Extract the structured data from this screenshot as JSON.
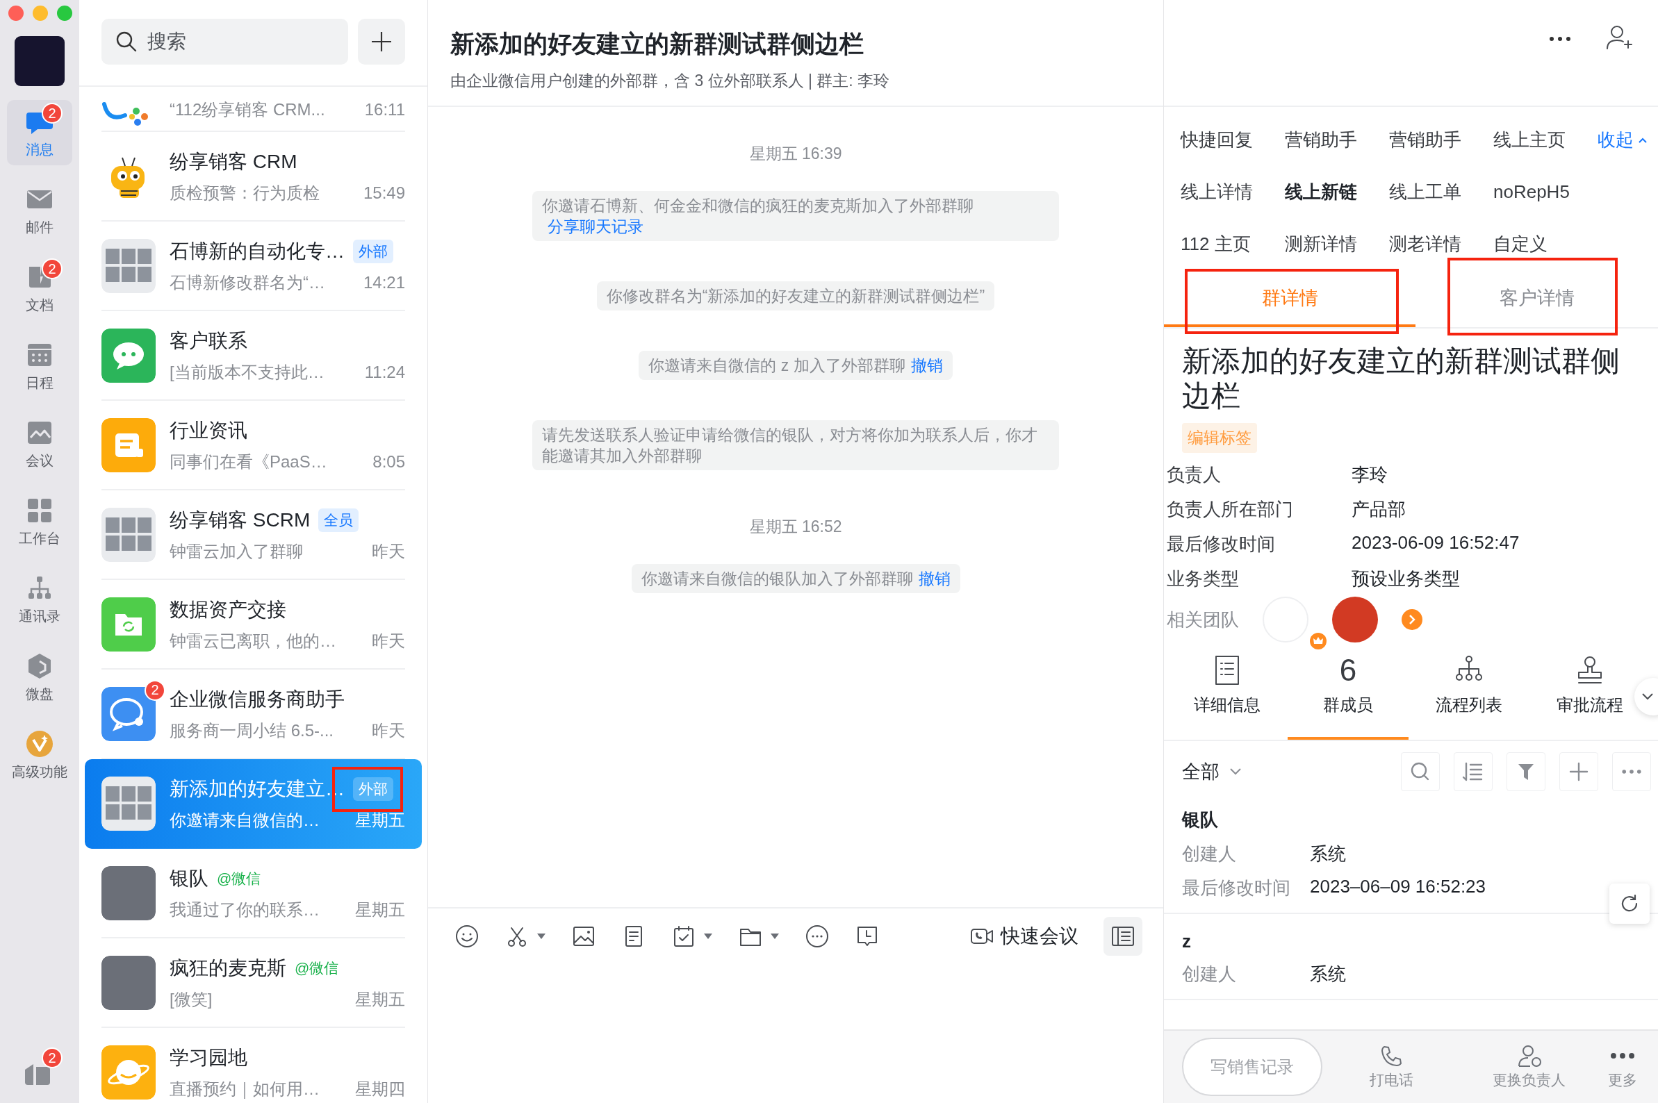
{
  "nav": {
    "items": [
      {
        "label": "消息",
        "selected": true,
        "badge": "2"
      },
      {
        "label": "邮件",
        "selected": false
      },
      {
        "label": "文档",
        "selected": false,
        "badge": "2"
      },
      {
        "label": "日程",
        "selected": false
      },
      {
        "label": "会议",
        "selected": false
      },
      {
        "label": "工作台",
        "selected": false
      },
      {
        "label": "通讯录",
        "selected": false
      },
      {
        "label": "微盘",
        "selected": false
      },
      {
        "label": "高级功能",
        "selected": false
      }
    ],
    "bottom_badge": "2"
  },
  "chat_list": {
    "search": {
      "placeholder": "搜索"
    },
    "items": [
      {
        "preview": "“112纷享销客 CRM...",
        "time": "16:11",
        "selected": false
      },
      {
        "title": "纷享销客 CRM",
        "preview": "质检预警：行为质检",
        "time": "15:49",
        "selected": false
      },
      {
        "title": "石博新的自动化专…",
        "tag": {
          "text": "外部",
          "kind": "blue"
        },
        "preview": "石博新修改群名为“…",
        "time": "14:21",
        "selected": false
      },
      {
        "title": "客户联系",
        "preview": "[当前版本不支持此…",
        "time": "11:24",
        "selected": false
      },
      {
        "title": "行业资讯",
        "preview": "同事们在看《PaaS…",
        "time": "8:05",
        "selected": false
      },
      {
        "title": "纷享销客 SCRM",
        "tag": {
          "text": "全员",
          "kind": "blue"
        },
        "preview": "钟雷云加入了群聊",
        "time": "昨天",
        "selected": false
      },
      {
        "title": "数据资产交接",
        "preview": "钟雷云已离职，他的…",
        "time": "昨天",
        "selected": false
      },
      {
        "title": "企业微信服务商助手",
        "badge": "2",
        "preview": "服务商一周小结 6.5-...",
        "time": "昨天",
        "selected": false
      },
      {
        "title": "新添加的好友建立…",
        "tag": {
          "text": "外部",
          "kind": "blue",
          "highlighted": true
        },
        "preview": "你邀请来自微信的…",
        "time": "星期五",
        "selected": true
      },
      {
        "title": "银队",
        "tag": {
          "text": "@微信",
          "kind": "green"
        },
        "preview": "我通过了你的联系…",
        "time": "星期五",
        "selected": false
      },
      {
        "title": "疯狂的麦克斯",
        "tag": {
          "text": "@微信",
          "kind": "green"
        },
        "preview": "[微笑]",
        "time": "星期五",
        "selected": false
      },
      {
        "title": "学习园地",
        "preview": "直播预约｜如何用…",
        "time": "星期四",
        "selected": false
      }
    ]
  },
  "chat": {
    "title": "新添加的好友建立的新群测试群侧边栏",
    "subtitle": "由企业微信用户创建的外部群，含 3 位外部联系人 | 群主: 李玲",
    "messages": [
      {
        "kind": "time",
        "text": "星期五 16:39"
      },
      {
        "kind": "notice",
        "text": "你邀请石博新、何金金和微信的疯狂的麦克斯加入了外部群聊",
        "link": "分享聊天记录"
      },
      {
        "kind": "notice",
        "text": "你修改群名为“新添加的好友建立的新群测试群侧边栏”"
      },
      {
        "kind": "notice",
        "text": "你邀请来自微信的 z 加入了外部群聊",
        "link": "撤销"
      },
      {
        "kind": "notice",
        "text": "请先发送联系人验证申请给微信的银队，对方将你加为联系人后，你才能邀请其加入外部群聊"
      },
      {
        "kind": "time",
        "text": "星期五 16:52"
      },
      {
        "kind": "notice",
        "text": "你邀请来自微信的银队加入了外部群聊",
        "link": "撤销"
      }
    ],
    "meeting_button": "快速会议"
  },
  "side_panel": {
    "app_tabs": [
      {
        "label": "快捷回复",
        "selected": false
      },
      {
        "label": "营销助手",
        "selected": false
      },
      {
        "label": "营销助手",
        "selected": false
      },
      {
        "label": "线上主页",
        "selected": false
      },
      {
        "label": "线上详情",
        "selected": false
      },
      {
        "label": "线上新链",
        "selected": true
      },
      {
        "label": "线上工单",
        "selected": false
      },
      {
        "label": "noRepH5",
        "selected": false
      },
      {
        "label": "112 主页",
        "selected": false
      },
      {
        "label": "测新详情",
        "selected": false
      },
      {
        "label": "测老详情",
        "selected": false
      },
      {
        "label": "自定义",
        "selected": false
      }
    ],
    "collapse": "收起",
    "detail_tabs": [
      {
        "label": "群详情",
        "selected": true,
        "highlighted": true
      },
      {
        "label": "客户详情",
        "selected": false,
        "highlighted": true
      }
    ],
    "group_name": "新添加的好友建立的新群测试群侧边栏",
    "tag_button": "编辑标签",
    "fields": [
      {
        "label": "负责人",
        "value": "李玲"
      },
      {
        "label": "负责人所在部门",
        "value": "产品部"
      },
      {
        "label": "最后修改时间",
        "value": "2023-06-09 16:52:47"
      },
      {
        "label": "业务类型",
        "value": "预设业务类型"
      }
    ],
    "team_label": "相关团队",
    "sections": [
      {
        "kind": "icon",
        "label": "详细信息",
        "selected": false
      },
      {
        "kind": "count",
        "count": "6",
        "label": "群成员",
        "selected": true
      },
      {
        "kind": "icon",
        "label": "流程列表",
        "selected": false
      },
      {
        "kind": "icon",
        "label": "审批流程",
        "selected": false
      }
    ],
    "filter": "全部",
    "members": [
      {
        "name": "银队",
        "fields": [
          {
            "label": "创建人",
            "value": "系统"
          },
          {
            "label": "最后修改时间",
            "value": "2023–06–09 16:52:23"
          }
        ]
      },
      {
        "name": "z",
        "fields": [
          {
            "label": "创建人",
            "value": "系统"
          }
        ]
      }
    ],
    "record_button": "写销售记录",
    "actions": [
      {
        "label": "打电话"
      },
      {
        "label": "更换负责人"
      },
      {
        "label": "更多"
      }
    ]
  }
}
